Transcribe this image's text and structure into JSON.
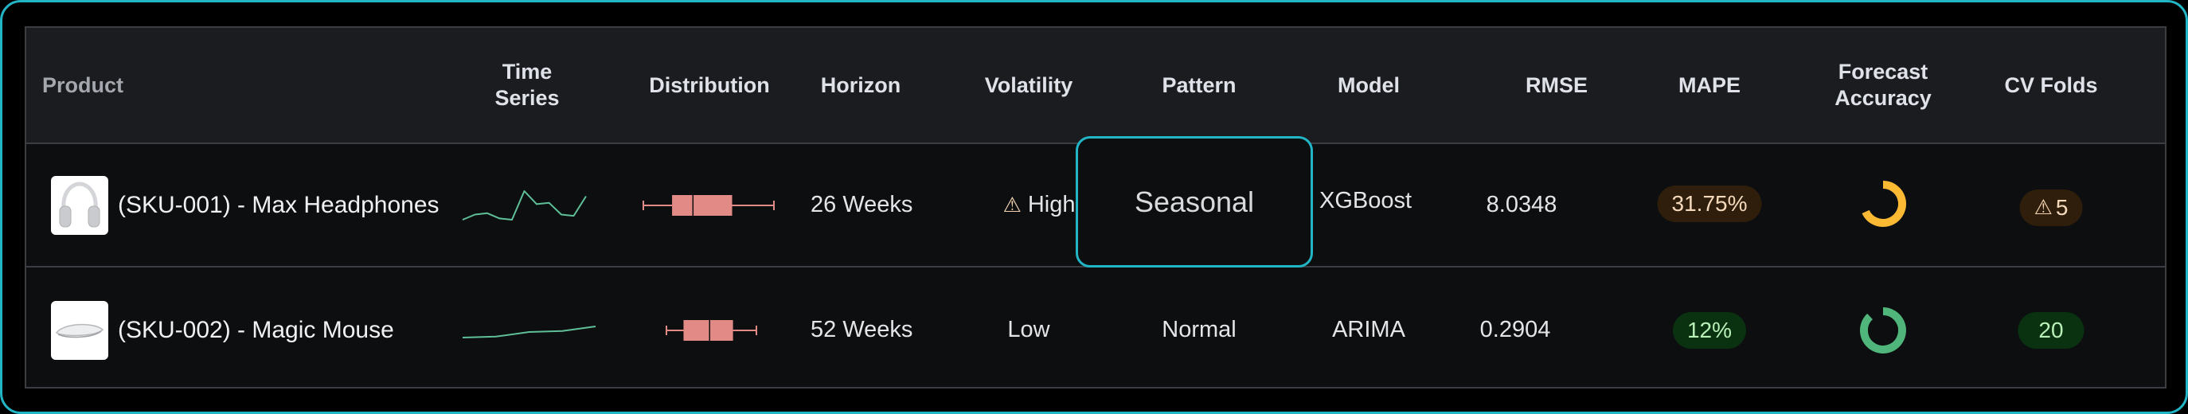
{
  "table": {
    "columns": [
      {
        "key": "product",
        "label": "Product"
      },
      {
        "key": "time_series",
        "label": "Time\nSeries"
      },
      {
        "key": "distribution",
        "label": "Distribution"
      },
      {
        "key": "horizon",
        "label": "Horizon"
      },
      {
        "key": "volatility",
        "label": "Volatility"
      },
      {
        "key": "pattern",
        "label": "Pattern"
      },
      {
        "key": "model",
        "label": "Model"
      },
      {
        "key": "rmse",
        "label": "RMSE"
      },
      {
        "key": "mape",
        "label": "MAPE"
      },
      {
        "key": "forecast_accuracy",
        "label": "Forecast\nAccuracy"
      },
      {
        "key": "cv_folds",
        "label": "CV Folds"
      }
    ],
    "header": {
      "product": "Product",
      "time_series_l1": "Time",
      "time_series_l2": "Series",
      "distribution": "Distribution",
      "horizon": "Horizon",
      "volatility": "Volatility",
      "pattern": "Pattern",
      "model": "Model",
      "rmse": "RMSE",
      "mape": "MAPE",
      "forecast_accuracy_l1": "Forecast",
      "forecast_accuracy_l2": "Accuracy",
      "cv_folds": "CV Folds"
    },
    "rows": [
      {
        "product": "(SKU-001) - Max Headphones",
        "thumbnail_icon": "headphones-image",
        "time_series": [
          2,
          6,
          7,
          3,
          2,
          24,
          14,
          15,
          6,
          5,
          20
        ],
        "distribution": {
          "min": 0,
          "q1": 22,
          "median": 38,
          "q3": 68,
          "max": 100
        },
        "horizon": "26 Weeks",
        "volatility": "High",
        "volatility_icon": "warning-icon",
        "pattern": "Seasonal",
        "pattern_selected": true,
        "model": "XGBoost",
        "rmse": "8.0348",
        "mape": "31.75%",
        "mape_status": "warning",
        "forecast_accuracy": 68.25,
        "forecast_accuracy_color": "#fbb934",
        "cv_folds": "5",
        "cv_folds_icon": "warning-icon",
        "cv_status": "warning"
      },
      {
        "product": "(SKU-002) - Magic Mouse",
        "thumbnail_icon": "mouse-image",
        "time_series": [
          0,
          1,
          6,
          7,
          12
        ],
        "distribution": {
          "min": 0,
          "q1": 19,
          "median": 48,
          "q3": 74,
          "max": 100
        },
        "horizon": "52 Weeks",
        "volatility": "Low",
        "pattern": "Normal",
        "pattern_selected": false,
        "model": "ARIMA",
        "rmse": "0.2904",
        "mape": "12%",
        "mape_status": "good",
        "forecast_accuracy": 88,
        "forecast_accuracy_color": "#4fb57a",
        "cv_folds": "20",
        "cv_status": "good"
      }
    ]
  },
  "colors": {
    "accent": "#22b5c6",
    "sparkline": "#5fbf98",
    "boxplot": "#e28a86",
    "warning_bg": "#2f1e0b",
    "warning_text": "#f5d9bd",
    "good_bg": "#0a3210",
    "good_text": "#b8f0b8"
  }
}
